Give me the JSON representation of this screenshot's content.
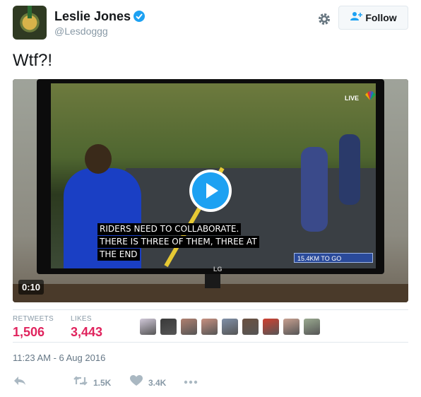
{
  "user": {
    "name": "Leslie Jones",
    "handle": "@Lesdoggg",
    "verified": true
  },
  "follow_button": {
    "label": "Follow"
  },
  "tweet": {
    "text": "Wtf?!"
  },
  "video": {
    "duration": "0:10",
    "captions": [
      "RIDERS NEED TO COLLABORATE.",
      "THERE IS THREE OF THEM, THREE AT",
      "THE END"
    ],
    "broadcast_badge": "LIVE",
    "distance_label": "15.4KM TO GO",
    "tv_brand": "LG"
  },
  "stats": {
    "retweets_label": "RETWEETS",
    "retweets_count": "1,506",
    "likes_label": "LIKES",
    "likes_count": "3,443"
  },
  "liker_avatar_colors": [
    "#d0c8d8",
    "#3a3a3a",
    "#b08070",
    "#c89080",
    "#8090a8",
    "#6a5040",
    "#d04030",
    "#c8a090",
    "#9aaa90"
  ],
  "timestamp": "11:23 AM - 6 Aug 2016",
  "actions": {
    "retweet_count": "1.5K",
    "like_count": "3.4K"
  },
  "colors": {
    "accent": "#1da1f2",
    "likes_red": "#e0245e",
    "muted": "#8899a6"
  },
  "icons": [
    "verified-badge-icon",
    "gear-icon",
    "follow-person-icon",
    "play-icon",
    "reply-icon",
    "retweet-icon",
    "heart-icon",
    "more-icon"
  ]
}
